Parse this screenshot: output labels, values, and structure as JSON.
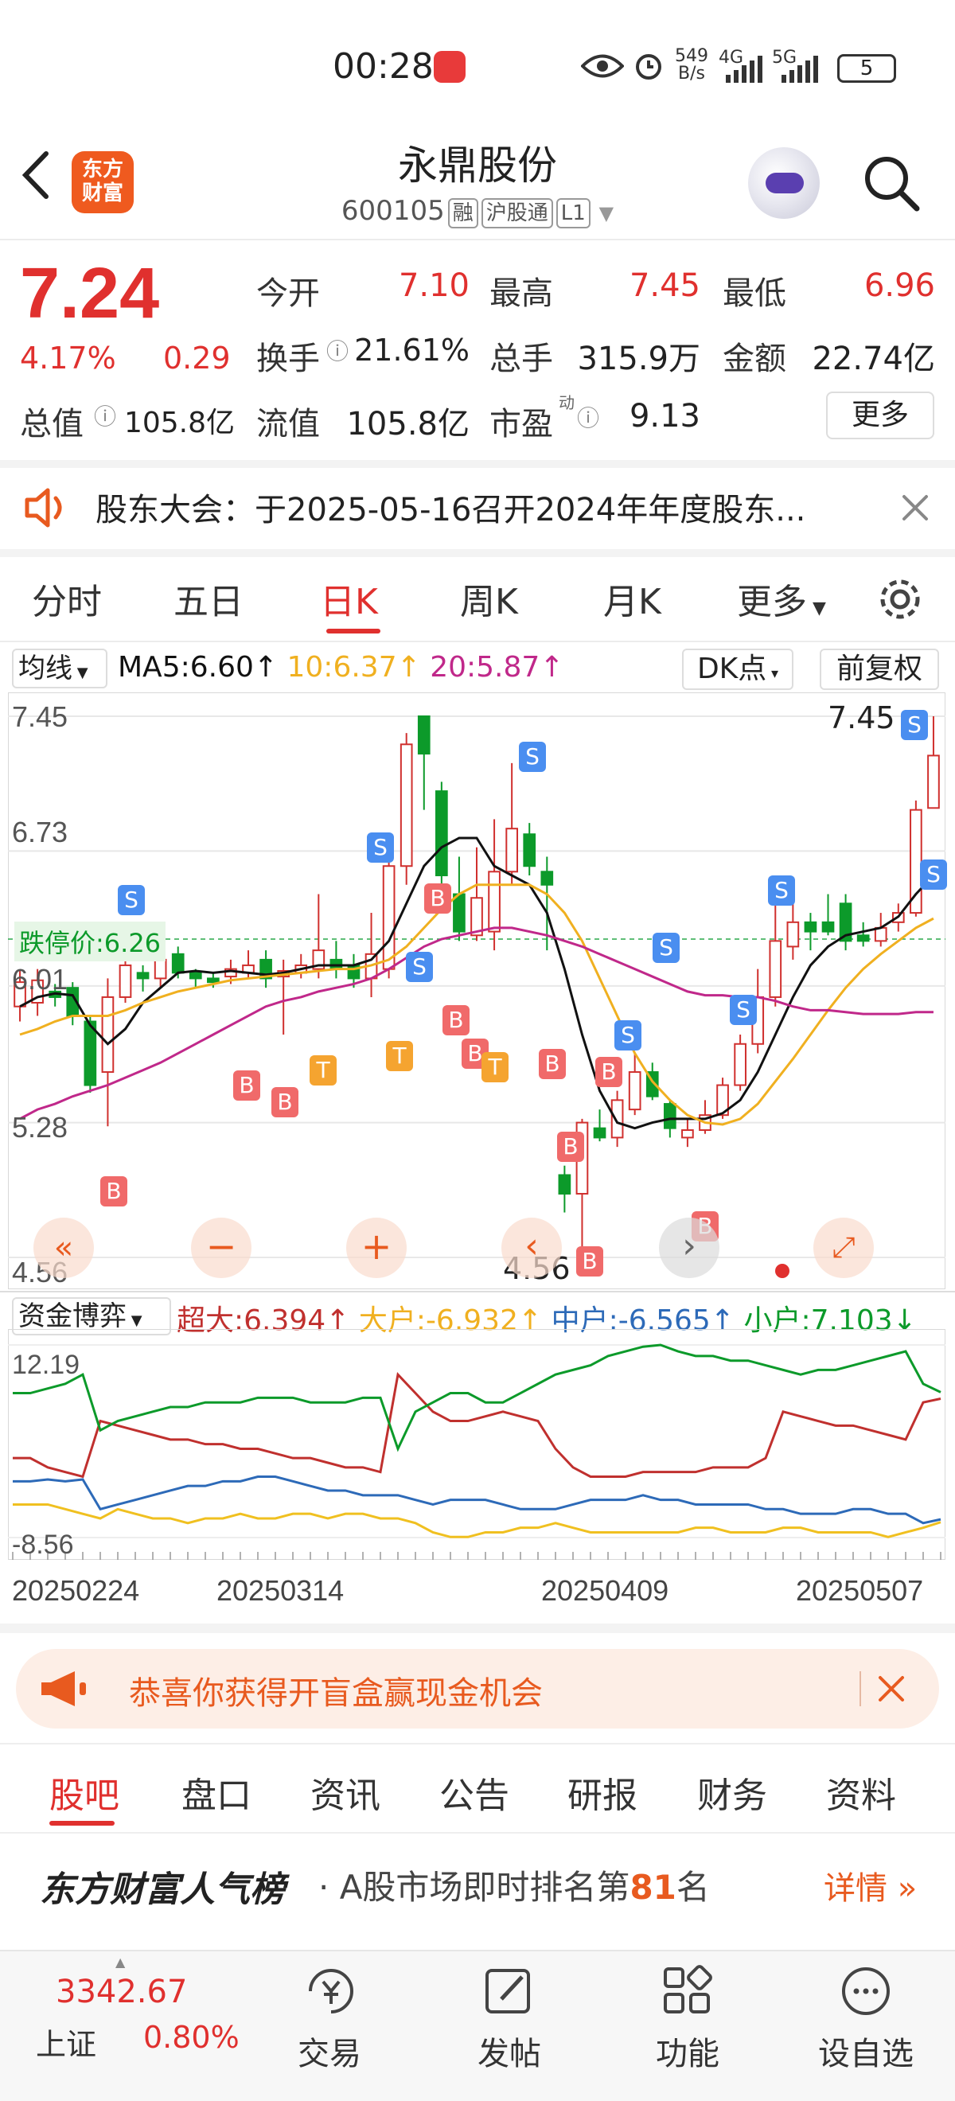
{
  "status": {
    "time": "00:28",
    "net_speed_top": "549",
    "net_speed_unit": "B/s",
    "g4": "4G",
    "g5": "5G",
    "battery": "5"
  },
  "header": {
    "logo_line1": "东方",
    "logo_line2": "财富",
    "name": "永鼎股份",
    "code": "600105",
    "tag1": "融",
    "tag2": "沪股通",
    "tag3": "L1"
  },
  "quote": {
    "price": "7.24",
    "pct": "4.17%",
    "chg": "0.29",
    "open_label": "今开",
    "open": "7.10",
    "high_label": "最高",
    "high": "7.45",
    "low_label": "最低",
    "low": "6.96",
    "turnover_label": "换手",
    "turnover": "21.61%",
    "vol_label": "总手",
    "vol": "315.9万",
    "amount_label": "金额",
    "amount": "22.74亿",
    "mktcap_label": "总值",
    "mktcap": "105.8亿",
    "float_label": "流值",
    "float": "105.8亿",
    "pe_label": "市盈",
    "pe_sup": "动",
    "pe": "9.13",
    "more": "更多"
  },
  "notice": {
    "text": "股东大会：于2025-05-16召开2024年年度股东..."
  },
  "tabs": [
    "分时",
    "五日",
    "日K",
    "周K",
    "月K",
    "更多"
  ],
  "chart_header": {
    "ma_select": "均线",
    "ma5": "MA5:6.60↑",
    "ma10": "10:6.37↑",
    "ma20": "20:5.87↑",
    "dk": "DK点",
    "fq": "前复权"
  },
  "kline": {
    "y_labels": [
      "7.45",
      "6.73",
      "6.01",
      "5.28",
      "4.56"
    ],
    "limit_label": "跌停价:6.26",
    "high_mark": "7.45",
    "low_mark": "4.56",
    "sig_B": "B",
    "sig_S": "S",
    "sig_T": "T"
  },
  "capital": {
    "select": "资金博弈",
    "super": "超大:6.394↑",
    "large": "大户:-6.932↑",
    "mid": "中户:-6.565↑",
    "small": "小户:7.103↓",
    "y_top": "12.19",
    "y_bot": "-8.56"
  },
  "x_labels": [
    "20250224",
    "20250314",
    "20250409",
    "20250507"
  ],
  "promo": {
    "text": "恭喜你获得开盲盒赢现金机会"
  },
  "bottom_tabs": [
    "股吧",
    "盘口",
    "资讯",
    "公告",
    "研报",
    "财务",
    "资料"
  ],
  "rank": {
    "title": "东方财富人气榜",
    "text_pre": "· A股市场即时排名第",
    "rank": "81",
    "text_post": "名",
    "detail": "详情"
  },
  "bottom_bar": {
    "index_val": "3342.67",
    "index_name": "上证",
    "index_pct": "0.80%",
    "trade": "交易",
    "post": "发帖",
    "func": "功能",
    "watch": "设自选"
  },
  "colors": {
    "up": "#e0302e",
    "down": "#0c9a2a",
    "accent": "#e85a1f",
    "ma5": "#111111",
    "ma10": "#f0b020",
    "ma20": "#c0288a"
  },
  "chart_data": [
    {
      "type": "candlestick",
      "title": "",
      "ylim": [
        4.56,
        7.45
      ],
      "y_ticks": [
        7.45,
        6.73,
        6.01,
        5.28,
        4.56
      ],
      "x_ticks": [
        "20250224",
        "20250314",
        "20250409",
        "20250507"
      ],
      "candles": [
        {
          "o": 5.9,
          "c": 6.03,
          "h": 6.09,
          "l": 5.82
        },
        {
          "o": 5.92,
          "c": 6.04,
          "h": 6.1,
          "l": 5.85
        },
        {
          "o": 5.98,
          "c": 5.95,
          "h": 6.02,
          "l": 5.9
        },
        {
          "o": 6.0,
          "c": 5.85,
          "h": 6.03,
          "l": 5.8
        },
        {
          "o": 5.82,
          "c": 5.48,
          "h": 5.85,
          "l": 5.44
        },
        {
          "o": 5.55,
          "c": 5.95,
          "h": 6.05,
          "l": 5.26
        },
        {
          "o": 5.95,
          "c": 6.12,
          "h": 6.18,
          "l": 5.92
        },
        {
          "o": 6.08,
          "c": 6.05,
          "h": 6.12,
          "l": 5.98
        },
        {
          "o": 6.05,
          "c": 6.15,
          "h": 6.2,
          "l": 6.0
        },
        {
          "o": 6.18,
          "c": 6.08,
          "h": 6.22,
          "l": 6.05
        },
        {
          "o": 6.08,
          "c": 6.05,
          "h": 6.1,
          "l": 6.0
        },
        {
          "o": 6.05,
          "c": 6.03,
          "h": 6.08,
          "l": 6.0
        },
        {
          "o": 6.06,
          "c": 6.1,
          "h": 6.15,
          "l": 6.02
        },
        {
          "o": 6.08,
          "c": 6.12,
          "h": 6.2,
          "l": 6.05
        },
        {
          "o": 6.15,
          "c": 6.05,
          "h": 6.2,
          "l": 6.0
        },
        {
          "o": 6.06,
          "c": 6.09,
          "h": 6.15,
          "l": 5.75
        },
        {
          "o": 6.08,
          "c": 6.12,
          "h": 6.18,
          "l": 6.05
        },
        {
          "o": 6.1,
          "c": 6.2,
          "h": 6.5,
          "l": 6.05
        },
        {
          "o": 6.15,
          "c": 6.1,
          "h": 6.25,
          "l": 6.05
        },
        {
          "o": 6.12,
          "c": 6.05,
          "h": 6.18,
          "l": 6.0
        },
        {
          "o": 6.05,
          "c": 6.18,
          "h": 6.4,
          "l": 5.95
        },
        {
          "o": 6.1,
          "c": 6.65,
          "h": 6.7,
          "l": 6.05
        },
        {
          "o": 6.65,
          "c": 7.3,
          "h": 7.36,
          "l": 6.55
        },
        {
          "o": 7.45,
          "c": 7.25,
          "h": 7.45,
          "l": 6.95
        },
        {
          "o": 7.05,
          "c": 6.6,
          "h": 7.1,
          "l": 6.5
        },
        {
          "o": 6.5,
          "c": 6.3,
          "h": 6.7,
          "l": 6.25
        },
        {
          "o": 6.28,
          "c": 6.48,
          "h": 6.75,
          "l": 6.25
        },
        {
          "o": 6.3,
          "c": 6.62,
          "h": 6.9,
          "l": 6.2
        },
        {
          "o": 6.62,
          "c": 6.85,
          "h": 7.2,
          "l": 6.55
        },
        {
          "o": 6.82,
          "c": 6.65,
          "h": 6.88,
          "l": 6.6
        },
        {
          "o": 6.62,
          "c": 6.55,
          "h": 6.7,
          "l": 6.2
        },
        {
          "o": 5.0,
          "c": 4.9,
          "h": 5.05,
          "l": 4.8
        },
        {
          "o": 4.9,
          "c": 5.28,
          "h": 5.3,
          "l": 4.56
        },
        {
          "o": 5.25,
          "c": 5.2,
          "h": 5.35,
          "l": 5.18
        },
        {
          "o": 5.2,
          "c": 5.4,
          "h": 5.45,
          "l": 5.15
        },
        {
          "o": 5.35,
          "c": 5.55,
          "h": 5.65,
          "l": 5.32
        },
        {
          "o": 5.55,
          "c": 5.42,
          "h": 5.6,
          "l": 5.4
        },
        {
          "o": 5.38,
          "c": 5.25,
          "h": 5.4,
          "l": 5.2
        },
        {
          "o": 5.2,
          "c": 5.24,
          "h": 5.3,
          "l": 5.15
        },
        {
          "o": 5.24,
          "c": 5.32,
          "h": 5.4,
          "l": 5.22
        },
        {
          "o": 5.32,
          "c": 5.48,
          "h": 5.52,
          "l": 5.3
        },
        {
          "o": 5.48,
          "c": 5.7,
          "h": 5.75,
          "l": 5.45
        },
        {
          "o": 5.7,
          "c": 5.95,
          "h": 6.1,
          "l": 5.65
        },
        {
          "o": 5.95,
          "c": 6.25,
          "h": 6.5,
          "l": 5.9
        },
        {
          "o": 6.22,
          "c": 6.35,
          "h": 6.55,
          "l": 6.15
        },
        {
          "o": 6.35,
          "c": 6.3,
          "h": 6.4,
          "l": 6.2
        },
        {
          "o": 6.35,
          "c": 6.3,
          "h": 6.5,
          "l": 6.28
        },
        {
          "o": 6.45,
          "c": 6.25,
          "h": 6.5,
          "l": 6.2
        },
        {
          "o": 6.28,
          "c": 6.25,
          "h": 6.35,
          "l": 6.22
        },
        {
          "o": 6.25,
          "c": 6.32,
          "h": 6.4,
          "l": 6.22
        },
        {
          "o": 6.35,
          "c": 6.4,
          "h": 6.45,
          "l": 6.3
        },
        {
          "o": 6.4,
          "c": 6.95,
          "h": 7.0,
          "l": 6.38
        },
        {
          "o": 6.96,
          "c": 7.24,
          "h": 7.45,
          "l": 6.96
        }
      ],
      "series": [
        {
          "name": "MA5",
          "values": [
            5.9,
            5.95,
            5.97,
            5.96,
            5.8,
            5.7,
            5.78,
            5.92,
            6.0,
            6.08,
            6.09,
            6.08,
            6.09,
            6.08,
            6.07,
            6.08,
            6.1,
            6.12,
            6.12,
            6.12,
            6.15,
            6.25,
            6.45,
            6.65,
            6.75,
            6.8,
            6.8,
            6.65,
            6.6,
            6.55,
            6.4,
            6.1,
            5.75,
            5.45,
            5.28,
            5.25,
            5.28,
            5.3,
            5.3,
            5.3,
            5.33,
            5.4,
            5.55,
            5.75,
            5.95,
            6.12,
            6.22,
            6.28,
            6.3,
            6.32,
            6.38,
            6.5,
            6.6
          ]
        },
        {
          "name": "10",
          "values": [
            5.75,
            5.78,
            5.82,
            5.85,
            5.85,
            5.85,
            5.88,
            5.92,
            5.95,
            5.98,
            6.0,
            6.02,
            6.04,
            6.05,
            6.06,
            6.07,
            6.08,
            6.09,
            6.1,
            6.1,
            6.12,
            6.15,
            6.22,
            6.32,
            6.42,
            6.5,
            6.55,
            6.55,
            6.55,
            6.55,
            6.5,
            6.4,
            6.25,
            6.05,
            5.85,
            5.65,
            5.5,
            5.4,
            5.32,
            5.28,
            5.27,
            5.3,
            5.38,
            5.5,
            5.62,
            5.75,
            5.88,
            6.0,
            6.1,
            6.18,
            6.25,
            6.32,
            6.37
          ]
        },
        {
          "name": "20",
          "values": [
            5.3,
            5.35,
            5.38,
            5.42,
            5.45,
            5.48,
            5.52,
            5.56,
            5.6,
            5.65,
            5.7,
            5.75,
            5.8,
            5.85,
            5.9,
            5.93,
            5.95,
            5.98,
            6.0,
            6.02,
            6.05,
            6.1,
            6.16,
            6.22,
            6.26,
            6.28,
            6.3,
            6.32,
            6.32,
            6.3,
            6.28,
            6.25,
            6.22,
            6.18,
            6.14,
            6.1,
            6.06,
            6.02,
            5.98,
            5.96,
            5.96,
            5.95,
            5.95,
            5.93,
            5.9,
            5.88,
            5.88,
            5.87,
            5.86,
            5.86,
            5.86,
            5.87,
            5.87
          ]
        }
      ]
    },
    {
      "type": "line",
      "title": "",
      "ylim": [
        -8.56,
        12.19
      ],
      "series": [
        {
          "name": "超大",
          "values": [
            0,
            0,
            -1,
            -1.5,
            -2,
            4,
            3.5,
            3,
            2.5,
            2,
            2,
            1.5,
            1.5,
            1,
            1,
            0.5,
            0,
            0,
            -0.5,
            -1,
            -1,
            -1.5,
            9,
            7,
            5,
            4,
            4,
            4.5,
            5,
            4.5,
            4,
            1,
            -1,
            -2,
            -2,
            -2,
            -1.5,
            -1.5,
            -1.5,
            -1.5,
            -1,
            -1,
            -1,
            0,
            5,
            4.5,
            4,
            3.5,
            3.5,
            3,
            2.5,
            2,
            6,
            6.4
          ]
        },
        {
          "name": "大户",
          "values": [
            -5,
            -5,
            -5,
            -5.5,
            -6,
            -6.5,
            -5.5,
            -6,
            -6.5,
            -6.5,
            -7,
            -6.5,
            -6.5,
            -6,
            -6.5,
            -6.5,
            -6,
            -6,
            -6.5,
            -6,
            -6,
            -6.5,
            -6.5,
            -7,
            -8,
            -8.5,
            -8.5,
            -8,
            -8,
            -7.5,
            -7.5,
            -7,
            -7.5,
            -8,
            -8,
            -8,
            -8,
            -8,
            -8,
            -7.5,
            -7.5,
            -8,
            -8,
            -8,
            -7.5,
            -7.5,
            -8,
            -8,
            -8,
            -8,
            -8.5,
            -8,
            -7.5,
            -6.9
          ]
        },
        {
          "name": "中户",
          "values": [
            -2.5,
            -2.5,
            -2.3,
            -2.5,
            -2.3,
            -5.5,
            -5,
            -4.5,
            -4,
            -3.5,
            -3,
            -3,
            -2.5,
            -2.5,
            -2,
            -2,
            -2.5,
            -3,
            -3.5,
            -3.5,
            -4,
            -4,
            -4,
            -4.5,
            -5,
            -4.5,
            -4.5,
            -4.5,
            -5,
            -5.5,
            -5.5,
            -5.5,
            -5,
            -4.5,
            -4.5,
            -4.5,
            -4,
            -4.5,
            -4.5,
            -5,
            -5,
            -5,
            -5,
            -5.5,
            -5.5,
            -6,
            -6,
            -6,
            -5.5,
            -5.5,
            -6,
            -6,
            -7,
            -6.6
          ]
        },
        {
          "name": "小户",
          "values": [
            7,
            7,
            7.5,
            8,
            9,
            3,
            4,
            4.5,
            5,
            5.5,
            5.5,
            6,
            6,
            6,
            6.5,
            6.5,
            6.5,
            6,
            6,
            6,
            6.5,
            6.5,
            1,
            5,
            6,
            7,
            7,
            6,
            6,
            7,
            8,
            9,
            9.5,
            10,
            11,
            11.5,
            12,
            12.19,
            11.5,
            11,
            11,
            10.5,
            10.5,
            10,
            9.5,
            9,
            9.5,
            9.5,
            10,
            10.5,
            11,
            11.5,
            8,
            7.1
          ]
        }
      ]
    }
  ]
}
